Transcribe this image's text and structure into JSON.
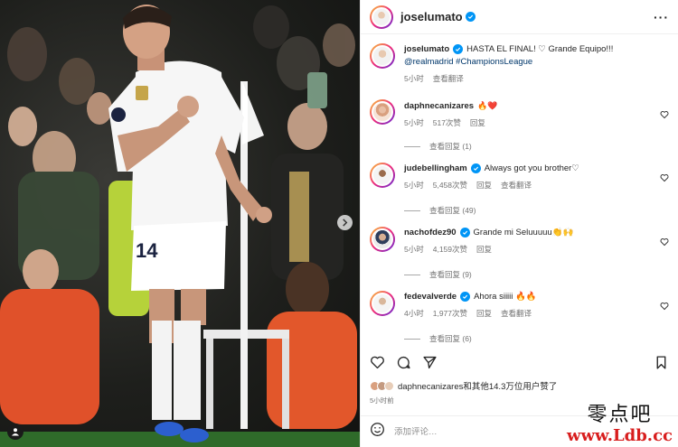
{
  "post": {
    "username": "joselumato",
    "caption": "HASTA EL FINAL! ♡ Grande Equipo!!!",
    "caption_tags": "@realmadrid #ChampionsLeague",
    "caption_time": "5小时",
    "caption_translate": "查看翻译"
  },
  "comments": [
    {
      "username": "daphnecanizares",
      "text": "🔥❤️",
      "time": "5小时",
      "likes": "517次赞",
      "reply": "回复",
      "translate": "",
      "view_replies": "查看回复 (1)",
      "verified": false
    },
    {
      "username": "judebellingham",
      "text": "Always got you brother♡",
      "time": "5小时",
      "likes": "5,458次赞",
      "reply": "回复",
      "translate": "查看翻译",
      "view_replies": "查看回复 (49)",
      "verified": true
    },
    {
      "username": "nachofdez90",
      "text": "Grande mi Seluuuuu👏🙌",
      "time": "5小时",
      "likes": "4,159次赞",
      "reply": "回复",
      "translate": "",
      "view_replies": "查看回复 (9)",
      "verified": true
    },
    {
      "username": "fedevalverde",
      "text": "Ahora siiiii 🔥🔥",
      "time": "4小时",
      "likes": "1,977次赞",
      "reply": "回复",
      "translate": "查看翻译",
      "view_replies": "查看回复 (6)",
      "verified": true
    }
  ],
  "likes_summary": "daphnecanizares和其他14.3万位用户赞了",
  "time_ago": "5小时前",
  "add_comment_placeholder": "添加评论…",
  "watermark": {
    "line1": "零点吧",
    "line2": "www.Ldb.cc"
  },
  "colors": {
    "verified": "#0095f6",
    "text": "#262626",
    "muted": "#737373",
    "link": "#00376b",
    "watermark_red": "#d81e1e"
  }
}
